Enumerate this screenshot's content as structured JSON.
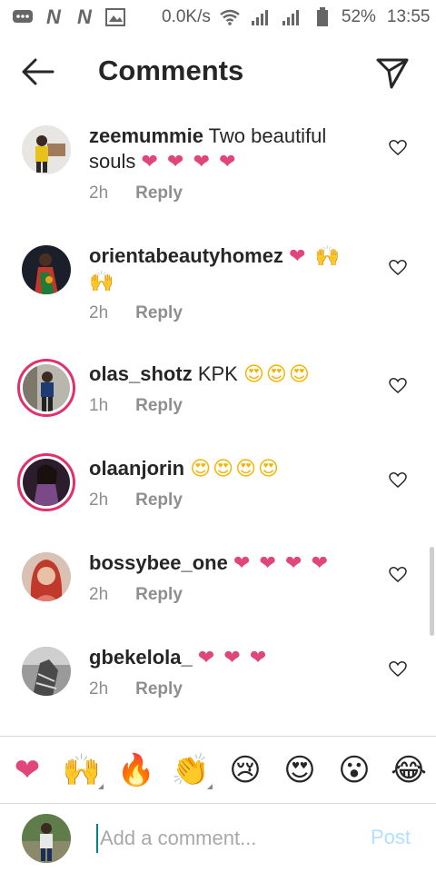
{
  "status_bar": {
    "network_speed": "0.0K/s",
    "battery": "52%",
    "time": "13:55",
    "icons": [
      "message-icon",
      "n-icon",
      "n-icon",
      "gallery-icon",
      "wifi-icon",
      "signal-icon",
      "signal-icon",
      "battery-icon"
    ]
  },
  "header": {
    "title": "Comments"
  },
  "comments": [
    {
      "username": "zeemummie",
      "text": "Two beautiful souls",
      "emoji": "❤ ❤ ❤ ❤",
      "time": "2h",
      "reply": "Reply"
    },
    {
      "username": "orientabeautyhomez",
      "text": "",
      "emoji": "❤ 🙌 🙌",
      "time": "2h",
      "reply": "Reply"
    },
    {
      "username": "olas_shotz",
      "text": "KPK",
      "emoji": "😍😍😍",
      "time": "1h",
      "reply": "Reply"
    },
    {
      "username": "olaanjorin",
      "text": "",
      "emoji": "😍😍😍😍",
      "time": "2h",
      "reply": "Reply"
    },
    {
      "username": "bossybee_one",
      "text": "",
      "emoji": "❤ ❤ ❤ ❤",
      "time": "2h",
      "reply": "Reply"
    },
    {
      "username": "gbekelola_",
      "text": "",
      "emoji": "❤ ❤ ❤",
      "time": "2h",
      "reply": "Reply"
    }
  ],
  "reactions": [
    "❤",
    "🙌",
    "🔥",
    "👏",
    "😢",
    "😍",
    "😮",
    "😂"
  ],
  "composer": {
    "placeholder": "Add a comment...",
    "post_label": "Post"
  },
  "colors": {
    "heart": "#e0457b",
    "story_ring": "#e1306c",
    "post_disabled": "#b2dffc",
    "meta_text": "#8e8e8e"
  }
}
